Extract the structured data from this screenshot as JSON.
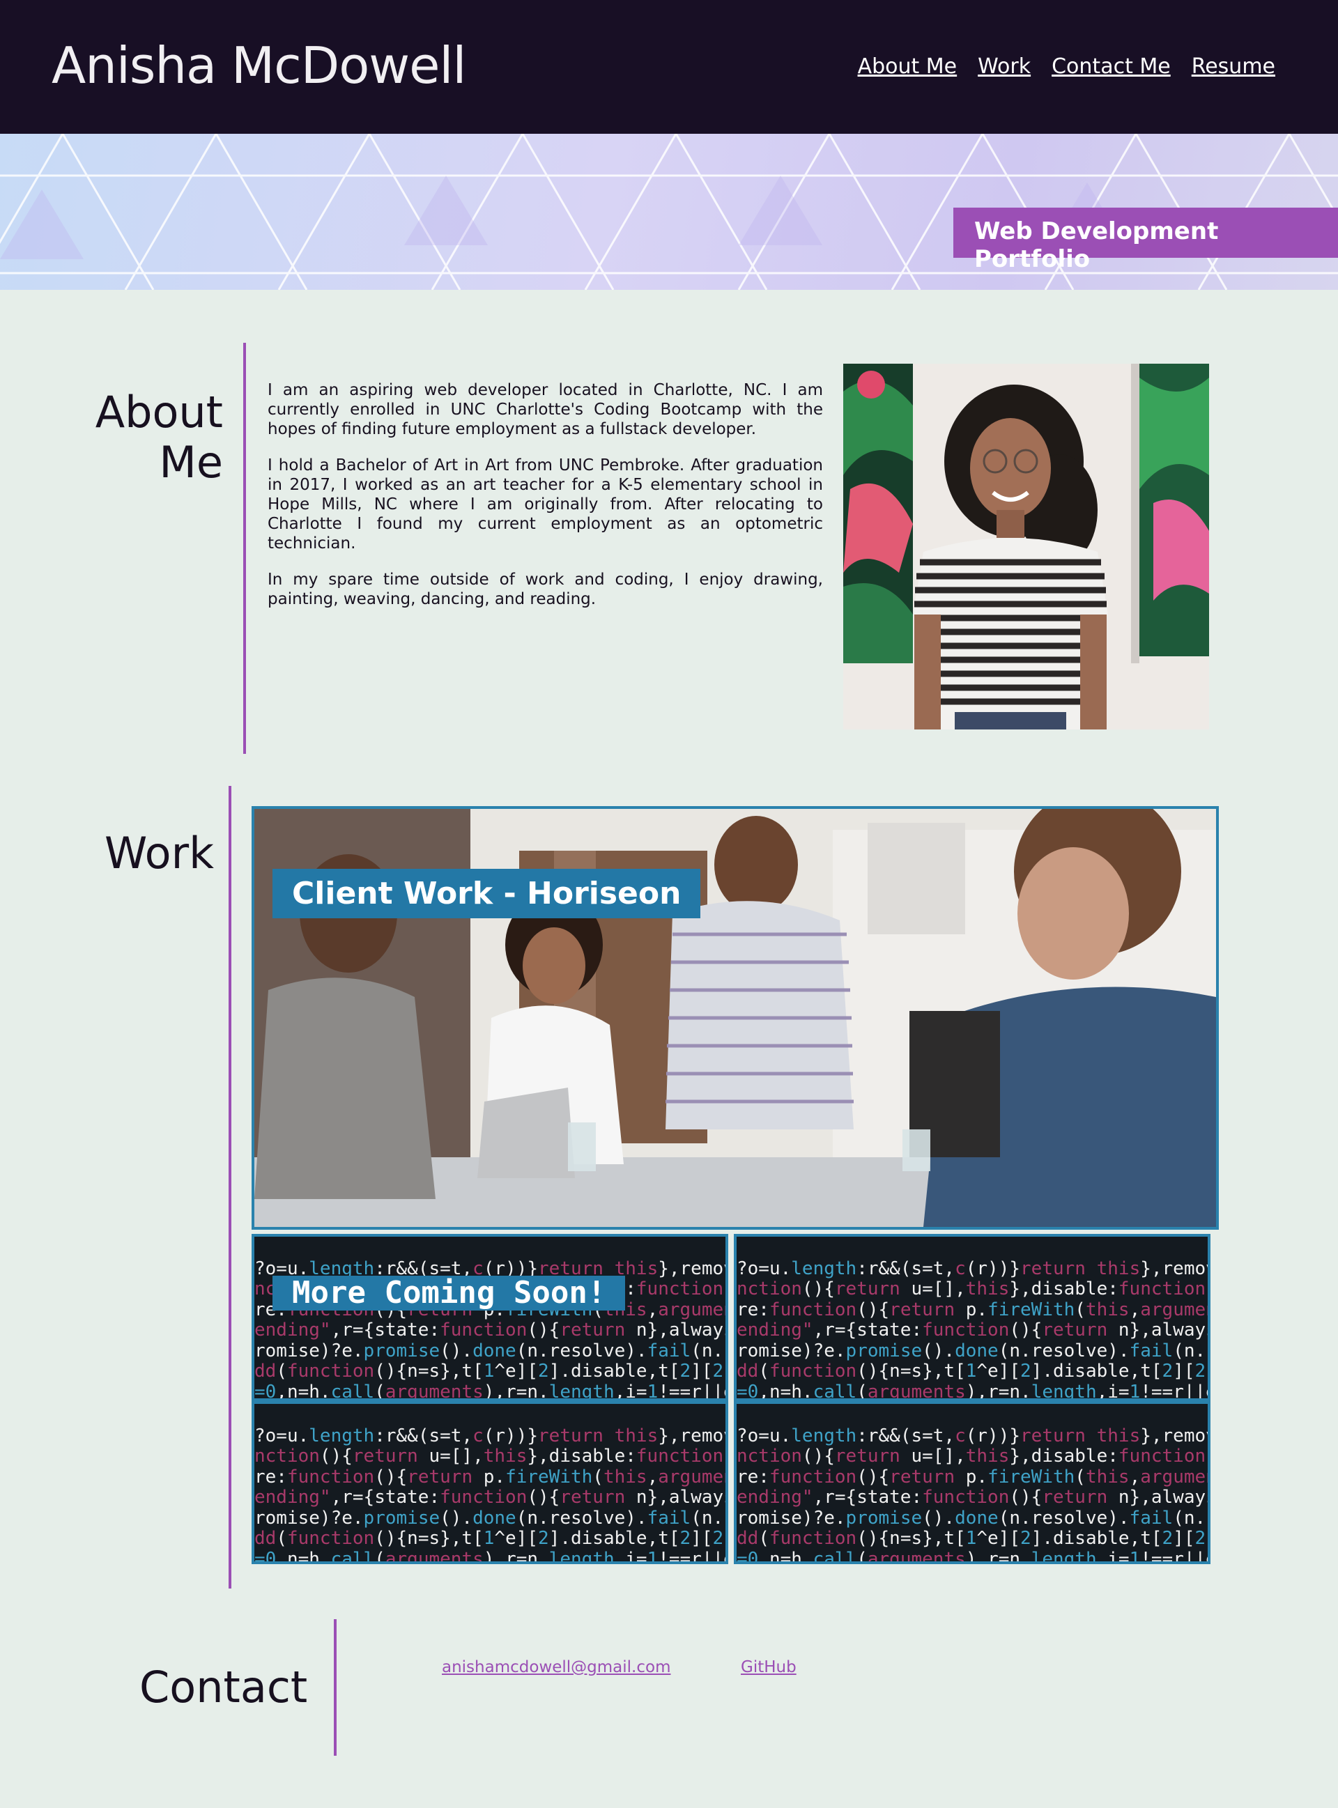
{
  "header": {
    "site_title": "Anisha McDowell",
    "nav": [
      "About Me",
      "Work",
      "Contact Me",
      "Resume"
    ]
  },
  "hero": {
    "badge": "Web Development Portfolio"
  },
  "about": {
    "heading_line1": "About",
    "heading_line2": "Me",
    "paragraphs": [
      "I am an aspiring web developer located in Charlotte, NC. I am currently enrolled in UNC Charlotte's Coding Bootcamp with the hopes of finding future employment as a fullstack developer.",
      "I hold a Bachelor of Art in Art from UNC Pembroke. After graduation in 2017, I worked as an art teacher for a K-5 elementary school in Hope Mills, NC where I am originally from. After relocating to Charlotte I found my current employment as an optometric technician.",
      "In my spare time outside of work and coding, I enjoy drawing, painting, weaving, dancing, and reading."
    ]
  },
  "work": {
    "heading": "Work",
    "featured_label": "Client Work - Horiseon",
    "more_label": "More Coming Soon!"
  },
  "contact": {
    "heading": "Contact",
    "email": "anishamcdowell@gmail.com",
    "github": "GitHub"
  },
  "colors": {
    "header_bg": "#180f25",
    "accent_purple": "#9b4fb5",
    "card_blue": "#2378a6",
    "page_bg": "#e6eee9"
  }
}
